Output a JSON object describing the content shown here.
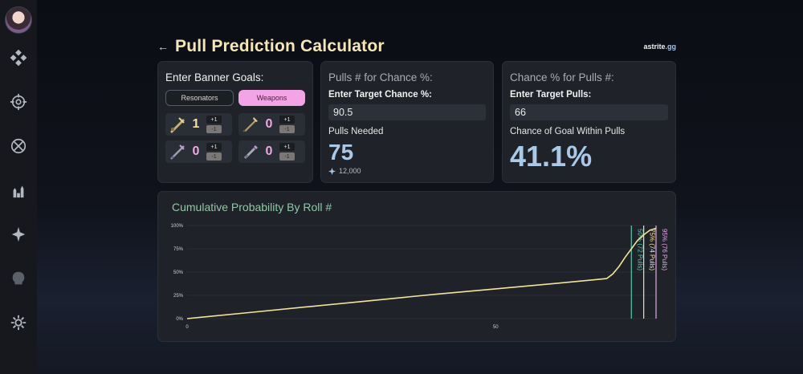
{
  "brand": {
    "name": "astrite",
    "tld": ".gg"
  },
  "header": {
    "back": "←",
    "title": "Pull Prediction Calculator"
  },
  "sidebar": {
    "items": [
      {
        "name": "home",
        "icon": "diamond-grid-icon"
      },
      {
        "name": "resonators",
        "icon": "compass-icon"
      },
      {
        "name": "tracker",
        "icon": "crossed-circle-icon"
      },
      {
        "name": "banners",
        "icon": "figures-icon"
      },
      {
        "name": "convene",
        "icon": "sparkle-icon"
      },
      {
        "name": "echoes",
        "icon": "skull-icon"
      },
      {
        "name": "settings",
        "icon": "gear-icon"
      }
    ]
  },
  "goals": {
    "heading": "Enter Banner Goals:",
    "tabs": {
      "resonators": "Resonators",
      "weapons": "Weapons"
    },
    "items": [
      {
        "icon": "gold-weapon-icon",
        "count": "1",
        "color": "#f4e29a",
        "plus": "+1",
        "minus": "-1"
      },
      {
        "icon": "gold-sword-icon",
        "count": "0",
        "color": "#f0a7e4",
        "plus": "+1",
        "minus": "-1"
      },
      {
        "icon": "purple-weapon-icon",
        "count": "0",
        "color": "#f0a7e4",
        "plus": "+1",
        "minus": "-1"
      },
      {
        "icon": "purple-gun-icon",
        "count": "0",
        "color": "#f0a7e4",
        "plus": "+1",
        "minus": "-1"
      }
    ]
  },
  "pulls_for_chance": {
    "heading": "Pulls # for Chance %:",
    "input_label": "Enter Target Chance %:",
    "input_value": "90.5",
    "result_label": "Pulls Needed",
    "result": "75",
    "cost": "12,000"
  },
  "chance_for_pulls": {
    "heading": "Chance % for Pulls #:",
    "input_label": "Enter Target Pulls:",
    "input_value": "66",
    "result_label": "Chance of Goal Within Pulls",
    "result": "41.1%"
  },
  "chart": {
    "title": "Cumulative Probability By Roll #"
  },
  "chart_data": {
    "type": "line",
    "title": "Cumulative Probability By Roll #",
    "x_ticks": [
      "0",
      "50"
    ],
    "y_ticks": [
      "0%",
      "25%",
      "50%",
      "75%",
      "100%"
    ],
    "xlim": [
      0,
      76
    ],
    "ylim": [
      0,
      100
    ],
    "series": [
      {
        "color": "#f3e49a",
        "x": [
          0,
          10,
          20,
          30,
          40,
          50,
          60,
          65,
          68,
          69,
          70,
          71,
          72,
          73,
          74,
          75,
          76
        ],
        "y": [
          0,
          6.5,
          13,
          19.5,
          26,
          32,
          38,
          41.1,
          43,
          48,
          56,
          66,
          75,
          84,
          90,
          95,
          97
        ]
      }
    ],
    "markers": [
      {
        "x": 72,
        "label": "50% (72 Pulls)",
        "color": "#4ecfae"
      },
      {
        "x": 74,
        "label": "75% (74 Pulls)",
        "color": "#f3e49a"
      },
      {
        "x": 76,
        "label": "95% (76 Pulls)",
        "color": "#e9a7e9"
      }
    ],
    "grid": true,
    "legend": "none"
  }
}
